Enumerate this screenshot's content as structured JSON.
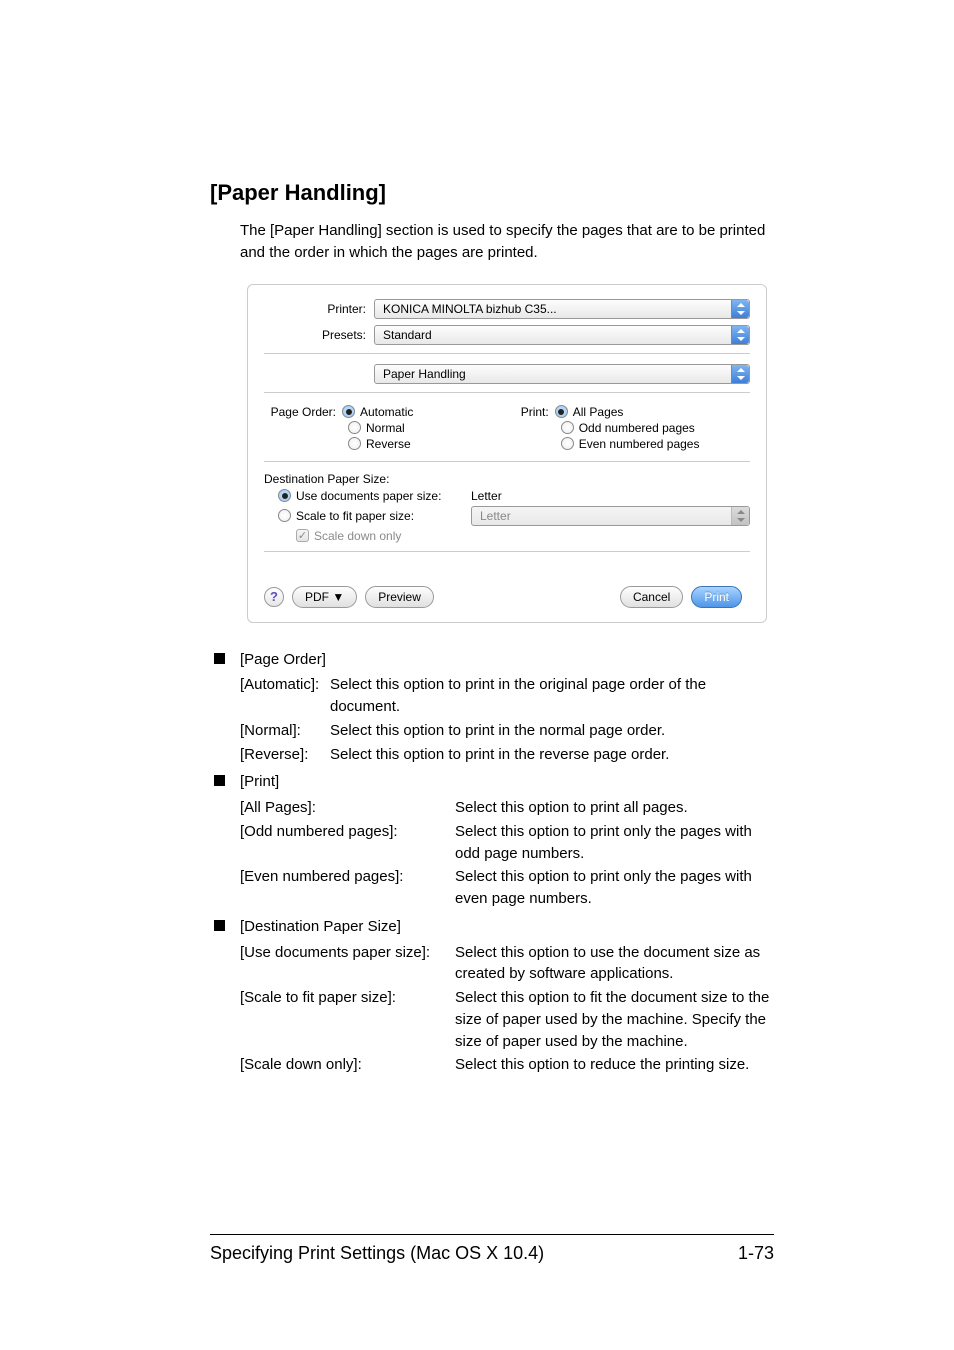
{
  "heading": "[Paper Handling]",
  "intro": "The [Paper Handling] section is used to specify the pages that are to be printed and the order in which the pages are printed.",
  "dialog": {
    "printer_label": "Printer:",
    "printer_value": "KONICA MINOLTA bizhub C35...",
    "presets_label": "Presets:",
    "presets_value": "Standard",
    "section_value": "Paper Handling",
    "page_order_label": "Page Order:",
    "page_order": {
      "automatic": "Automatic",
      "normal": "Normal",
      "reverse": "Reverse"
    },
    "print_label": "Print:",
    "print_opts": {
      "all": "All Pages",
      "odd": "Odd numbered pages",
      "even": "Even numbered pages"
    },
    "dest_label": "Destination Paper Size:",
    "use_docs_label": "Use documents paper size:",
    "use_docs_value": "Letter",
    "scale_fit_label": "Scale to fit paper size:",
    "scale_fit_value": "Letter",
    "scale_down_label": "Scale down only",
    "help": "?",
    "pdf": "PDF ▼",
    "preview": "Preview",
    "cancel": "Cancel",
    "print_btn": "Print"
  },
  "sections": {
    "page_order": {
      "title": "[Page Order]",
      "automatic": {
        "term": "[Automatic]:",
        "val": "Select this option to print in the original page order of the document."
      },
      "normal": {
        "term": "[Normal]:",
        "val": "Select this option to print in the normal page order."
      },
      "reverse": {
        "term": "[Reverse]:",
        "val": "Select this option to print in the reverse page order."
      }
    },
    "print": {
      "title": "[Print]",
      "all": {
        "term": "[All Pages]:",
        "val": "Select this option to print all pages."
      },
      "odd": {
        "term": "[Odd numbered pages]:",
        "val": "Select this option to print only the pages with odd page numbers."
      },
      "even": {
        "term": "[Even numbered pages]:",
        "val": "Select this option to print only the pages with even page numbers."
      }
    },
    "dest": {
      "title": "[Destination Paper Size]",
      "use": {
        "term": "[Use documents paper size]:",
        "val": "Select this option to use the document size as created by software applications."
      },
      "scale": {
        "term": "[Scale to fit paper size]:",
        "val": "Select this option to fit the document size to the size of paper used by the machine. Specify the size of paper used by the machine."
      },
      "down": {
        "term": "[Scale down only]:",
        "val": "Select this option to reduce the printing size."
      }
    }
  },
  "footer": {
    "left": "Specifying Print Settings (Mac OS X 10.4)",
    "right": "1-73"
  }
}
